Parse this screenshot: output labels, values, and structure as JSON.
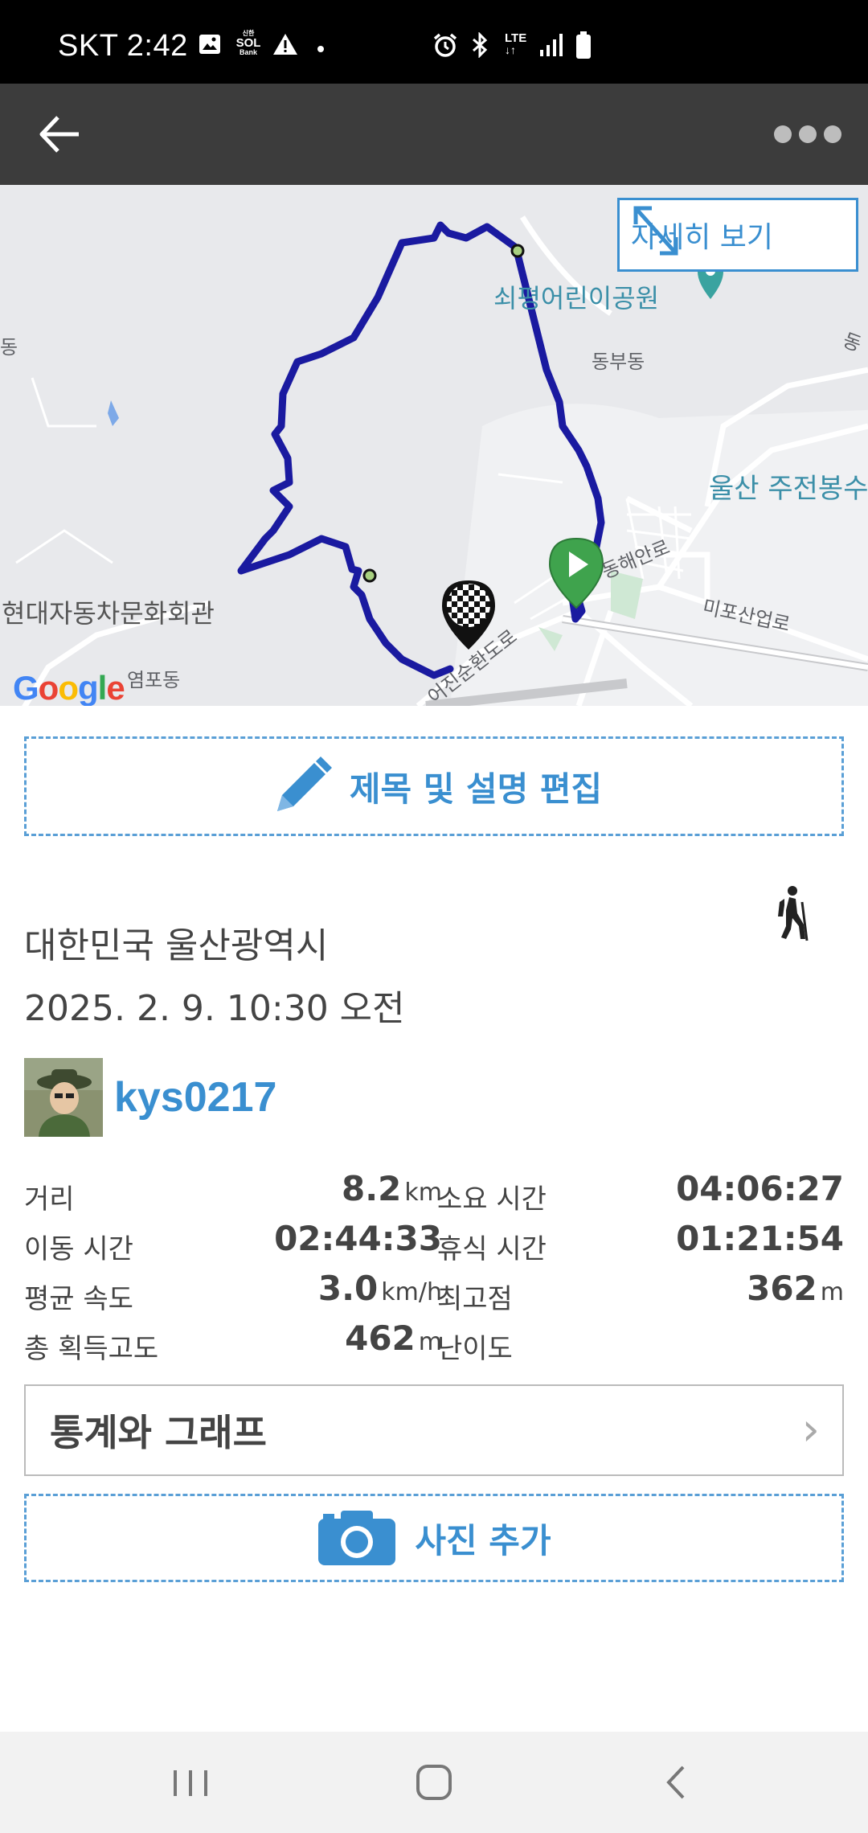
{
  "status_bar": {
    "carrier_time": "SKT 2:42",
    "network": "LTE",
    "bank_badge": "SOL"
  },
  "app_bar": {
    "back_icon": "arrow-left-icon",
    "more_icon": "more-dots-icon"
  },
  "map": {
    "expand_label": "자세히 보기",
    "labels": {
      "playground": "쇠평어린이공원",
      "dongbudong": "동부동",
      "ulsan_station": "울산 주전봉수",
      "hyundai_hall": "현대자동차문화회관",
      "yeompodong": "염포동",
      "mipo_road": "미포산업로",
      "donghae_road": "동해안로",
      "left_edge": "동",
      "right_edge": "동",
      "bottom_road": "어진순환도로"
    },
    "google_logo": "Google",
    "route_color": "#1a1aa0"
  },
  "edit_button": {
    "label": "제목 및 설명 편집",
    "icon": "pencil-icon"
  },
  "activity": {
    "location": "대한민국 울산광역시",
    "datetime": "2025. 2. 9. 10:30 오전",
    "activity_icon": "hiker-icon"
  },
  "user": {
    "username": "kys0217"
  },
  "stats": {
    "distance_label": "거리",
    "distance_value": "8.2",
    "distance_unit": "km",
    "duration_label": "소요 시간",
    "duration_value": "04:06:27",
    "moving_label": "이동 시간",
    "moving_value": "02:44:33",
    "rest_label": "휴식 시간",
    "rest_value": "01:21:54",
    "avg_speed_label": "평균 속도",
    "avg_speed_value": "3.0",
    "avg_speed_unit": "km/h",
    "max_alt_label": "최고점",
    "max_alt_value": "362",
    "max_alt_unit": "m",
    "gain_label": "총 획득고도",
    "gain_value": "462",
    "gain_unit": "m",
    "difficulty_label": "난이도",
    "difficulty_value": ""
  },
  "stats_graph_button": {
    "label": "통계와 그래프",
    "chevron": "›"
  },
  "photo_button": {
    "label": "사진 추가",
    "icon": "camera-icon"
  },
  "nav_bar": {
    "recent_icon": "recent-apps-icon",
    "home_icon": "home-icon",
    "back_icon": "back-chevron-icon"
  }
}
